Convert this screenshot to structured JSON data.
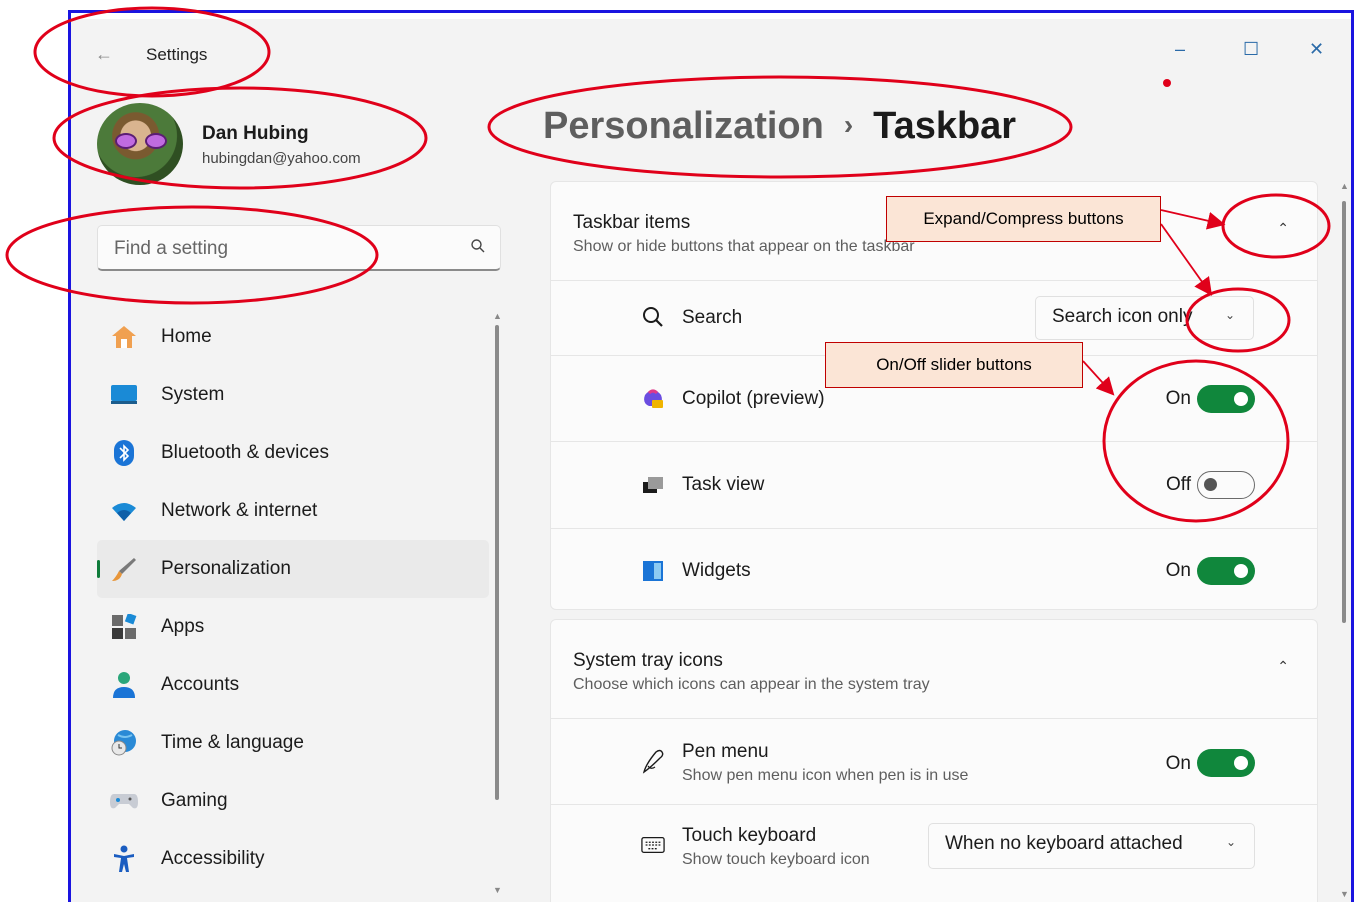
{
  "window": {
    "title": "Settings",
    "back_icon": "back-arrow-icon",
    "minimize_glyph": "–",
    "maximize_glyph": "☐",
    "close_glyph": "✕"
  },
  "profile": {
    "name": "Dan Hubing",
    "email": "hubingdan@yahoo.com"
  },
  "search": {
    "placeholder": "Find a setting",
    "icon": "search-icon"
  },
  "sidebar": {
    "items": [
      {
        "label": "Home",
        "icon": "home-icon"
      },
      {
        "label": "System",
        "icon": "system-monitor-icon"
      },
      {
        "label": "Bluetooth & devices",
        "icon": "bluetooth-icon"
      },
      {
        "label": "Network & internet",
        "icon": "wifi-icon"
      },
      {
        "label": "Personalization",
        "icon": "paintbrush-icon",
        "active": true
      },
      {
        "label": "Apps",
        "icon": "apps-icon"
      },
      {
        "label": "Accounts",
        "icon": "accounts-icon"
      },
      {
        "label": "Time & language",
        "icon": "globe-clock-icon"
      },
      {
        "label": "Gaming",
        "icon": "gamepad-icon"
      },
      {
        "label": "Accessibility",
        "icon": "accessibility-icon"
      }
    ]
  },
  "breadcrumb": {
    "parent": "Personalization",
    "separator": "›",
    "current": "Taskbar"
  },
  "taskbar_items": {
    "title": "Taskbar items",
    "subtitle": "Show or hide buttons that appear on the taskbar",
    "rows": [
      {
        "label": "Search",
        "icon": "search-icon",
        "control": "dropdown",
        "value": "Search icon only"
      },
      {
        "label": "Copilot (preview)",
        "icon": "copilot-icon",
        "control": "toggle",
        "state": "On"
      },
      {
        "label": "Task view",
        "icon": "task-view-icon",
        "control": "toggle",
        "state": "Off"
      },
      {
        "label": "Widgets",
        "icon": "widgets-icon",
        "control": "toggle",
        "state": "On"
      }
    ]
  },
  "system_tray": {
    "title": "System tray icons",
    "subtitle": "Choose which icons can appear in the system tray",
    "rows": [
      {
        "label": "Pen menu",
        "sub": "Show pen menu icon when pen is in use",
        "icon": "pen-icon",
        "control": "toggle",
        "state": "On"
      },
      {
        "label": "Touch keyboard",
        "sub": "Show touch keyboard icon",
        "icon": "keyboard-icon",
        "control": "dropdown",
        "value": "When no keyboard attached"
      }
    ]
  },
  "annotations": {
    "expand_label": "Expand/Compress buttons",
    "slider_label": "On/Off slider buttons",
    "annotation_color": "#e0001a"
  },
  "colors": {
    "accent": "#10873c",
    "frame_border": "#1a14e0"
  }
}
